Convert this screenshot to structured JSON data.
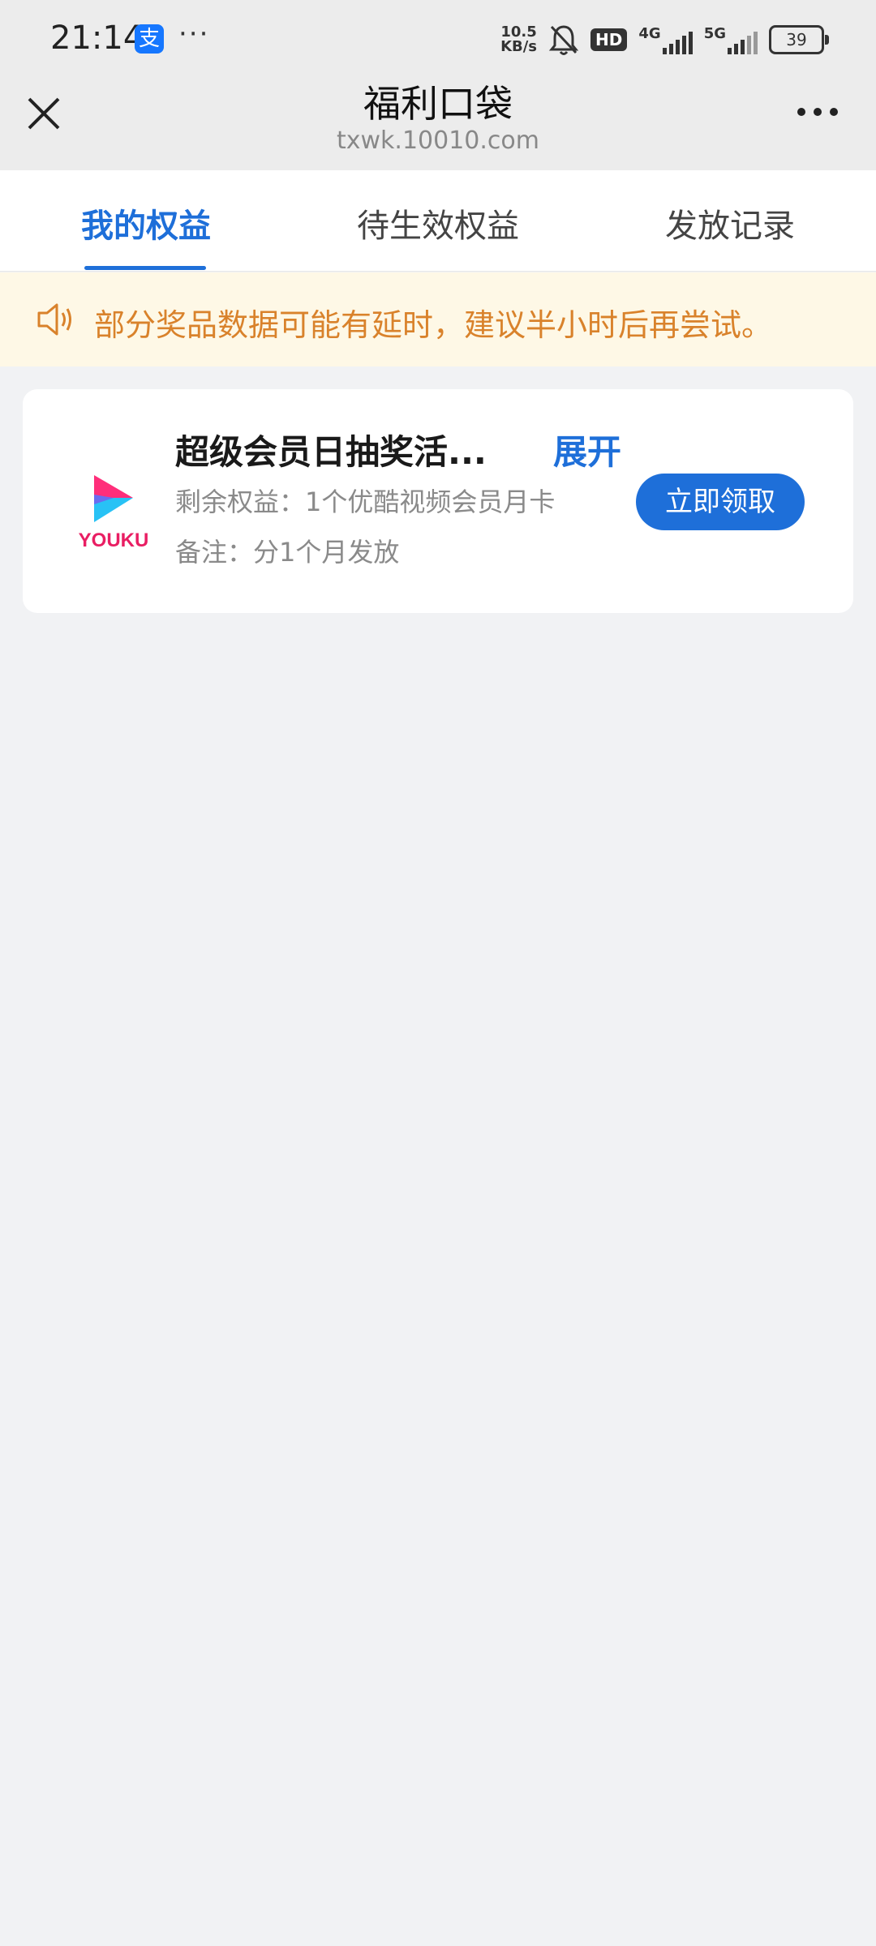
{
  "status_bar": {
    "time": "21:14",
    "alipay_glyph": "支",
    "dots": "···",
    "speed_top": "10.5",
    "speed_bottom": "KB/s",
    "hd": "HD",
    "net1": "4G",
    "net2": "5G",
    "battery": "39"
  },
  "header": {
    "title": "福利口袋",
    "url": "txwk.10010.com"
  },
  "tabs": [
    {
      "label": "我的权益"
    },
    {
      "label": "待生效权益"
    },
    {
      "label": "发放记录"
    }
  ],
  "notice": {
    "text": "部分奖品数据可能有延时，建议半小时后再尝试。"
  },
  "card": {
    "title": "超级会员日抽奖活...",
    "expand_label": "展开",
    "remaining": "剩余权益：1个优酷视频会员月卡",
    "note": "备注：分1个月发放",
    "claim_label": "立即领取",
    "logo_text": "YOUKU"
  },
  "colors": {
    "accent": "#1e6fd9",
    "notice_text": "#d9822b",
    "notice_bg": "#fef8e6"
  }
}
